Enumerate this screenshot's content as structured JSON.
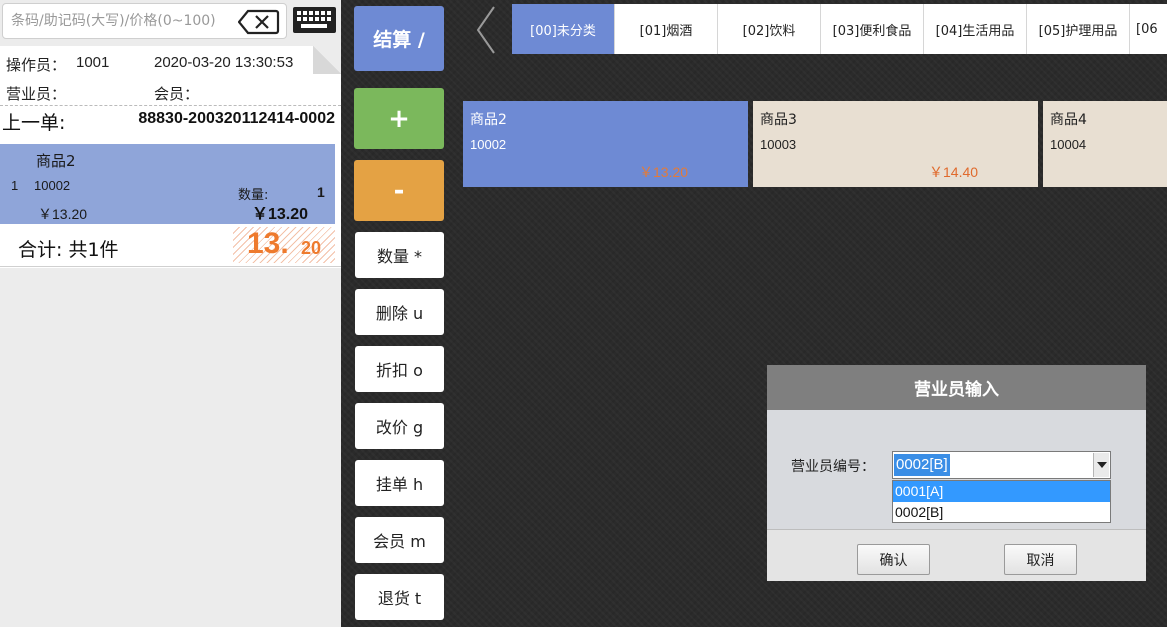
{
  "search": {
    "placeholder": "条码/助记码(大写)/价格(0~100)"
  },
  "receipt": {
    "operator_label": "操作员：",
    "operator_value": "1001",
    "datetime": "2020-03-20 13:30:53",
    "clerk_label": "营业员：",
    "member_label": "会员：",
    "prev_order_label": "上一单:",
    "prev_order_value": "88830-200320112414-0002",
    "items": [
      {
        "index": "1",
        "name": "商品2",
        "code": "10002",
        "unit_price": "￥13.20",
        "qty_label": "数量:",
        "qty": "1",
        "subtotal": "￥13.20"
      }
    ],
    "total_label": "合计: 共1件",
    "total_int": "13.",
    "total_dec": "20"
  },
  "buttons": {
    "checkout": "结算  /",
    "plus": "+",
    "minus": "-",
    "functions": [
      "数量 *",
      "删除 u",
      "折扣 o",
      "改价 g",
      "挂单 h",
      "会员 m",
      "退货 t"
    ]
  },
  "categories": [
    "[00]未分类",
    "[01]烟酒",
    "[02]饮料",
    "[03]便利食品",
    "[04]生活用品",
    "[05]护理用品",
    "[06"
  ],
  "active_category_index": 0,
  "products": [
    {
      "name": "商品2",
      "code": "10002",
      "price": "￥13.20",
      "selected": true
    },
    {
      "name": "商品3",
      "code": "10003",
      "price": "￥14.40",
      "selected": false
    },
    {
      "name": "商品4",
      "code": "10004",
      "price": "",
      "selected": false
    }
  ],
  "dialog": {
    "title": "营业员输入",
    "field_label": "营业员编号：",
    "selected_value": "0002[B]",
    "options": [
      "0001[A]",
      "0002[B]"
    ],
    "highlighted_option_index": 0,
    "confirm_label": "确认",
    "cancel_label": "取消"
  },
  "colors": {
    "accent_blue": "#6e8ad4",
    "plus_green": "#7bb85c",
    "minus_orange": "#e4a244",
    "price_orange": "#ee7a2d"
  },
  "icons": [
    "backspace-icon",
    "keyboard-icon",
    "chevron-left-icon",
    "chevron-down-icon"
  ]
}
